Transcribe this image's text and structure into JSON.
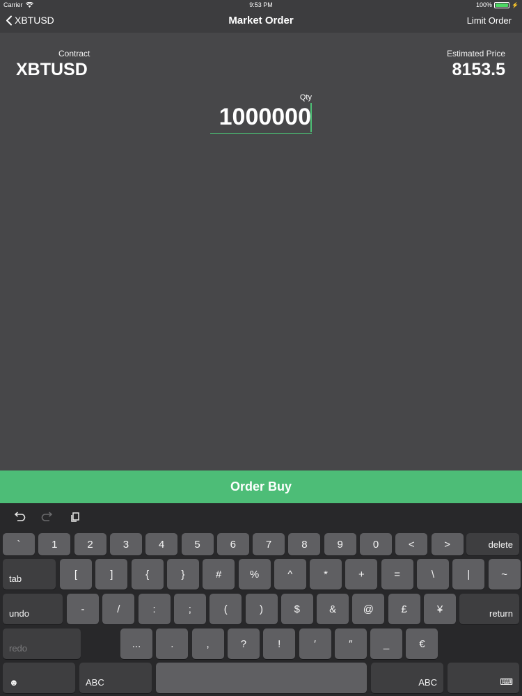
{
  "status": {
    "carrier": "Carrier",
    "time": "9:53 PM",
    "battery": "100%",
    "battery_level": 1.0
  },
  "nav": {
    "back_label": "XBTUSD",
    "title": "Market Order",
    "right_label": "Limit Order"
  },
  "order": {
    "contract_label": "Contract",
    "contract_value": "XBTUSD",
    "price_label": "Estimated Price",
    "price_value": "8153.5",
    "qty_label": "Qty",
    "qty_value": "1000000"
  },
  "order_button": {
    "label": "Order Buy"
  },
  "colors": {
    "accent": "#4dbd77",
    "background": "#474749",
    "bar": "#3d3d3f",
    "keyboard": "#28282a",
    "key": "#5f5f62"
  },
  "keyboard": {
    "toolbar": [
      {
        "name": "undo-icon",
        "glyph": "⮌"
      },
      {
        "name": "redo-icon",
        "glyph": "⮎"
      },
      {
        "name": "paste-icon",
        "glyph": "⧉"
      }
    ],
    "row1": [
      "`",
      "1",
      "2",
      "3",
      "4",
      "5",
      "6",
      "7",
      "8",
      "9",
      "0",
      "<",
      ">"
    ],
    "row1_special": "delete",
    "row2_special": "tab",
    "row2": [
      "[",
      "]",
      "{",
      "}",
      "#",
      "%",
      "^",
      "*",
      "+",
      "=",
      "\\",
      "|",
      "~"
    ],
    "row3_special_left": "undo",
    "row3": [
      "-",
      "/",
      ":",
      ";",
      "(",
      ")",
      "$",
      "&",
      "@",
      "£",
      "¥"
    ],
    "row3_special_right": "return",
    "row4_special_left": "redo",
    "row4": [
      "...",
      ".",
      ",",
      "?",
      "!",
      "′",
      "″",
      "_",
      "€"
    ],
    "row5_emoji": "☻",
    "row5_abc_left": "ABC",
    "row5_abc_right": "ABC",
    "row5_dismiss": "⌨"
  }
}
